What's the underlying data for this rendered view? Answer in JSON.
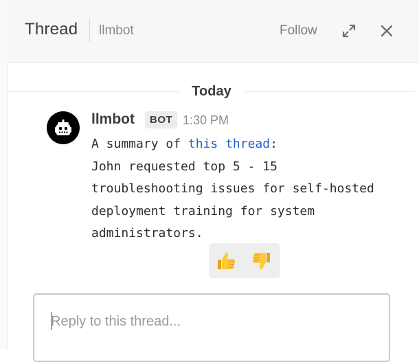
{
  "header": {
    "title": "Thread",
    "channel": "llmbot",
    "follow_label": "Follow",
    "expand_icon": "expand-icon",
    "close_icon": "close-icon"
  },
  "divider": {
    "label": "Today"
  },
  "post": {
    "author": "llmbot",
    "badge": "BOT",
    "time": "1:30 PM",
    "text_prefix": "A summary of ",
    "link_text": "this thread",
    "text_suffix": ":\nJohn requested top 5 - 15\ntroubleshooting issues for self-hosted\ndeployment training for system\nadministrators.",
    "avatar_icon": "robot-icon",
    "reactions": [
      {
        "emoji": "👍",
        "icon": "thumbs-up-icon"
      },
      {
        "emoji": "👎",
        "icon": "thumbs-down-icon"
      }
    ]
  },
  "reply": {
    "placeholder": "Reply to this thread..."
  },
  "colors": {
    "link": "#1f5fc8",
    "reaction_bg": "#eeeeee",
    "avatar_bg": "#000000"
  }
}
